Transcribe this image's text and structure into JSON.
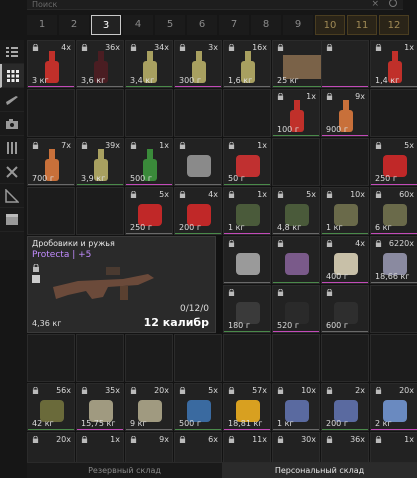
{
  "search": {
    "placeholder": "Поиск",
    "clear": "×"
  },
  "pages": [
    "1",
    "2",
    "3",
    "4",
    "5",
    "6",
    "7",
    "8",
    "9",
    "10",
    "11",
    "12"
  ],
  "active_page": "3",
  "locked_pages": [
    "10",
    "11",
    "12"
  ],
  "rail_icons": [
    "grid-icon",
    "weapons-icon",
    "camera-icon",
    "tools-icon",
    "wrench-icon",
    "ruler-icon",
    "box-icon"
  ],
  "big_item": {
    "name": "Дробовики и ружья",
    "mod": "Protecta | +5",
    "ammo": "0/12/0",
    "caliber": "12 калибр",
    "weight": "4,36 кг"
  },
  "items": [
    {
      "id": "r1c1",
      "count": "4x",
      "weight": "3 кг",
      "icon": "red-bottle"
    },
    {
      "id": "r1c2",
      "count": "36x",
      "weight": "3,6 кг",
      "icon": "dark-bottle"
    },
    {
      "id": "r1c3",
      "count": "34x",
      "weight": "3,4 кг",
      "icon": "champagne-bottle"
    },
    {
      "id": "r1c4",
      "count": "3x",
      "weight": "300 г",
      "icon": "champagne-bottle"
    },
    {
      "id": "r1c5",
      "count": "16x",
      "weight": "1,6 кг",
      "icon": "champagne-bottle"
    },
    {
      "id": "r1c6",
      "count": "5x",
      "weight": "25 кг",
      "icon": "wooden-crate"
    },
    {
      "id": "r1c8",
      "count": "",
      "weight": "",
      "icon": ""
    },
    {
      "id": "r1c8b",
      "count": "1x",
      "weight": "1,4 кг",
      "icon": "red-bottle"
    },
    {
      "id": "r2c6",
      "count": "1x",
      "weight": "100 г",
      "icon": "red-bottle"
    },
    {
      "id": "r2c7",
      "count": "9x",
      "weight": "900 г",
      "icon": "orange-bottle"
    },
    {
      "id": "r3c1",
      "count": "7x",
      "weight": "700 г",
      "icon": "orange-bottle"
    },
    {
      "id": "r3c2",
      "count": "39x",
      "weight": "3,9 кг",
      "icon": "champagne-bottle"
    },
    {
      "id": "r3c3",
      "count": "1x",
      "weight": "500 г",
      "icon": "green-bottle"
    },
    {
      "id": "r3c4",
      "count": "",
      "weight": "",
      "icon": "gas-mask"
    },
    {
      "id": "r3c5",
      "count": "1x",
      "weight": "50 г",
      "icon": "flare"
    },
    {
      "id": "r3c8",
      "count": "5x",
      "weight": "250 г",
      "icon": "dynamite"
    },
    {
      "id": "r4c3",
      "count": "5x",
      "weight": "250 г",
      "icon": "dynamite"
    },
    {
      "id": "r4c4",
      "count": "4x",
      "weight": "200 г",
      "icon": "dynamite"
    },
    {
      "id": "r4c5",
      "count": "1x",
      "weight": "1 кг",
      "icon": "backpack"
    },
    {
      "id": "r4c6",
      "count": "5x",
      "weight": "4,8 кг",
      "icon": "backpack"
    },
    {
      "id": "r4c7",
      "count": "10x",
      "weight": "1 кг",
      "icon": "bandage"
    },
    {
      "id": "r4c8",
      "count": "60x",
      "weight": "6 кг",
      "icon": "bandage"
    },
    {
      "id": "r5c5",
      "count": "",
      "weight": "",
      "icon": "mask"
    },
    {
      "id": "r5c6",
      "count": "",
      "weight": "",
      "icon": "demon-mask"
    },
    {
      "id": "r5c7",
      "count": "4x",
      "weight": "400 г",
      "icon": "rolled-bandage"
    },
    {
      "id": "r5c8",
      "count": "6220x",
      "weight": "18,66 кг",
      "icon": "ammo-pile"
    },
    {
      "id": "r6c5",
      "count": "",
      "weight": "180 г",
      "icon": "scope"
    },
    {
      "id": "r6c6",
      "count": "",
      "weight": "520 г",
      "icon": "suppressor"
    },
    {
      "id": "r6c7",
      "count": "",
      "weight": "600 г",
      "icon": "magazine"
    },
    {
      "id": "r8c1",
      "count": "56x",
      "weight": "42 кг",
      "icon": "sandbag"
    },
    {
      "id": "r8c2",
      "count": "35x",
      "weight": "15,75 кг",
      "icon": "rock-pile"
    },
    {
      "id": "r8c3",
      "count": "20x",
      "weight": "9 кг",
      "icon": "rock-pile"
    },
    {
      "id": "r8c4",
      "count": "5x",
      "weight": "500 г",
      "icon": "inhaler"
    },
    {
      "id": "r8c5",
      "count": "57x",
      "weight": "18,81 кг",
      "icon": "crystal"
    },
    {
      "id": "r8c6",
      "count": "10x",
      "weight": "1 кг",
      "icon": "battery"
    },
    {
      "id": "r8c7",
      "count": "2x",
      "weight": "200 г",
      "icon": "battery"
    },
    {
      "id": "r8c8",
      "count": "20x",
      "weight": "2 кг",
      "icon": "chip"
    },
    {
      "id": "r9c1",
      "count": "20x",
      "weight": "",
      "icon": ""
    },
    {
      "id": "r9c2",
      "count": "1x",
      "weight": "",
      "icon": ""
    },
    {
      "id": "r9c3",
      "count": "9x",
      "weight": "",
      "icon": ""
    },
    {
      "id": "r9c4",
      "count": "6x",
      "weight": "",
      "icon": ""
    },
    {
      "id": "r9c5",
      "count": "11x",
      "weight": "",
      "icon": ""
    },
    {
      "id": "r9c6",
      "count": "30x",
      "weight": "",
      "icon": ""
    },
    {
      "id": "r9c7",
      "count": "36x",
      "weight": "",
      "icon": ""
    },
    {
      "id": "r9c8",
      "count": "1x",
      "weight": "",
      "icon": ""
    }
  ],
  "bottom_tabs": {
    "left": "Резервный склад",
    "right": "Персональный склад"
  }
}
